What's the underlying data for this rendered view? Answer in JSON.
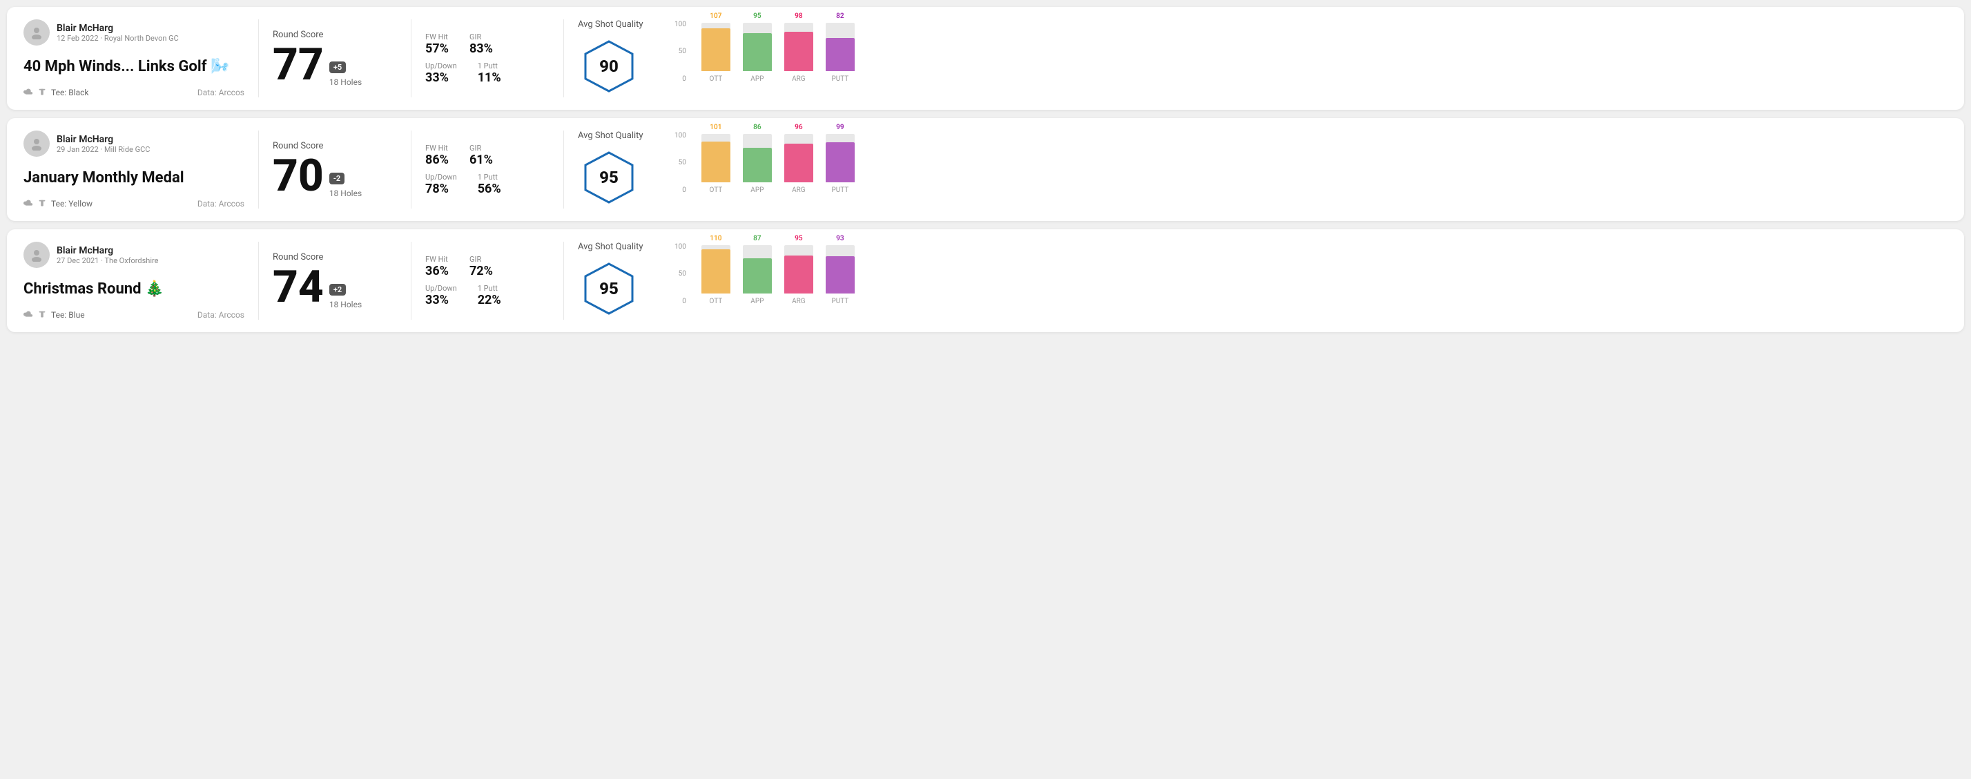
{
  "cards": [
    {
      "id": "card1",
      "user": {
        "name": "Blair McHarg",
        "date": "12 Feb 2022 · Royal North Devon GC"
      },
      "title": "40 Mph Winds... Links Golf 🌬️",
      "tee": "Black",
      "data_source": "Data: Arccos",
      "round": {
        "label": "Round Score",
        "score": "77",
        "badge": "+5",
        "badge_type": "positive",
        "holes": "18 Holes"
      },
      "stats": {
        "fw_hit_label": "FW Hit",
        "fw_hit_value": "57%",
        "gir_label": "GIR",
        "gir_value": "83%",
        "updown_label": "Up/Down",
        "updown_value": "33%",
        "one_putt_label": "1 Putt",
        "one_putt_value": "11%"
      },
      "quality": {
        "label": "Avg Shot Quality",
        "value": "90"
      },
      "chart": {
        "bars": [
          {
            "label": "OTT",
            "value": 107,
            "max": 120,
            "color": "#f5a623"
          },
          {
            "label": "APP",
            "value": 95,
            "max": 120,
            "color": "#4caf50"
          },
          {
            "label": "ARG",
            "value": 98,
            "max": 120,
            "color": "#e91e63"
          },
          {
            "label": "PUTT",
            "value": 82,
            "max": 120,
            "color": "#9c27b0"
          }
        ],
        "y_labels": [
          "100",
          "50",
          "0"
        ]
      }
    },
    {
      "id": "card2",
      "user": {
        "name": "Blair McHarg",
        "date": "29 Jan 2022 · Mill Ride GCC"
      },
      "title": "January Monthly Medal",
      "tee": "Yellow",
      "data_source": "Data: Arccos",
      "round": {
        "label": "Round Score",
        "score": "70",
        "badge": "-2",
        "badge_type": "negative",
        "holes": "18 Holes"
      },
      "stats": {
        "fw_hit_label": "FW Hit",
        "fw_hit_value": "86%",
        "gir_label": "GIR",
        "gir_value": "61%",
        "updown_label": "Up/Down",
        "updown_value": "78%",
        "one_putt_label": "1 Putt",
        "one_putt_value": "56%"
      },
      "quality": {
        "label": "Avg Shot Quality",
        "value": "95"
      },
      "chart": {
        "bars": [
          {
            "label": "OTT",
            "value": 101,
            "max": 120,
            "color": "#f5a623"
          },
          {
            "label": "APP",
            "value": 86,
            "max": 120,
            "color": "#4caf50"
          },
          {
            "label": "ARG",
            "value": 96,
            "max": 120,
            "color": "#e91e63"
          },
          {
            "label": "PUTT",
            "value": 99,
            "max": 120,
            "color": "#9c27b0"
          }
        ],
        "y_labels": [
          "100",
          "50",
          "0"
        ]
      }
    },
    {
      "id": "card3",
      "user": {
        "name": "Blair McHarg",
        "date": "27 Dec 2021 · The Oxfordshire"
      },
      "title": "Christmas Round 🎄",
      "tee": "Blue",
      "data_source": "Data: Arccos",
      "round": {
        "label": "Round Score",
        "score": "74",
        "badge": "+2",
        "badge_type": "positive",
        "holes": "18 Holes"
      },
      "stats": {
        "fw_hit_label": "FW Hit",
        "fw_hit_value": "36%",
        "gir_label": "GIR",
        "gir_value": "72%",
        "updown_label": "Up/Down",
        "updown_value": "33%",
        "one_putt_label": "1 Putt",
        "one_putt_value": "22%"
      },
      "quality": {
        "label": "Avg Shot Quality",
        "value": "95"
      },
      "chart": {
        "bars": [
          {
            "label": "OTT",
            "value": 110,
            "max": 120,
            "color": "#f5a623"
          },
          {
            "label": "APP",
            "value": 87,
            "max": 120,
            "color": "#4caf50"
          },
          {
            "label": "ARG",
            "value": 95,
            "max": 120,
            "color": "#e91e63"
          },
          {
            "label": "PUTT",
            "value": 93,
            "max": 120,
            "color": "#9c27b0"
          }
        ],
        "y_labels": [
          "100",
          "50",
          "0"
        ]
      }
    }
  ]
}
